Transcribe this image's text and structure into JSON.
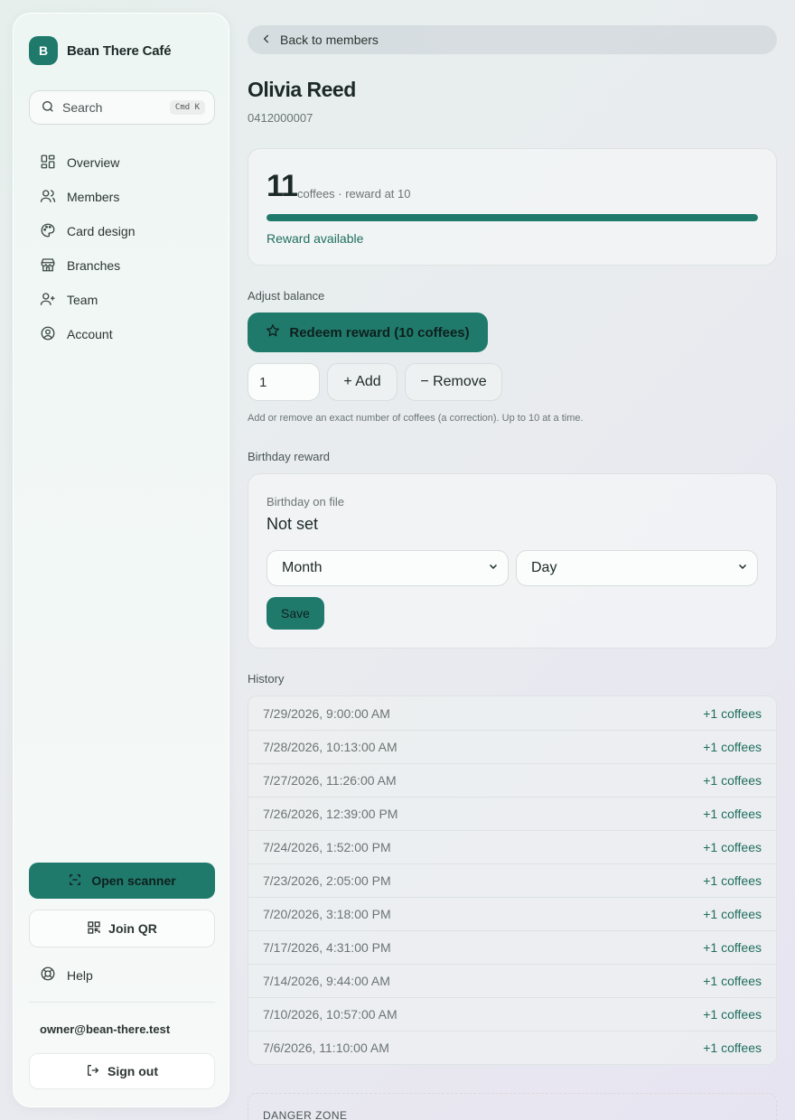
{
  "brand": {
    "logo_letter": "B",
    "name": "Bean There Café"
  },
  "search": {
    "placeholder": "Search",
    "shortcut": "Cmd K"
  },
  "nav": [
    {
      "label": "Overview",
      "icon": "grid-icon"
    },
    {
      "label": "Members",
      "icon": "users-icon"
    },
    {
      "label": "Card design",
      "icon": "palette-icon"
    },
    {
      "label": "Branches",
      "icon": "store-icon"
    },
    {
      "label": "Team",
      "icon": "user-plus-icon"
    },
    {
      "label": "Account",
      "icon": "user-circle-icon"
    }
  ],
  "sidebar_footer": {
    "scanner_label": "Open scanner",
    "joinqr_label": "Join QR",
    "help_label": "Help",
    "owner_email": "owner@bean-there.test",
    "signout_label": "Sign out"
  },
  "main": {
    "back_label": "Back to members",
    "member_name": "Olivia Reed",
    "member_phone": "0412000007",
    "balance": {
      "count": "11",
      "caption": "coffees · reward at 10",
      "progress_fraction": 1.0,
      "status": "Reward available"
    },
    "adjust": {
      "section_label": "Adjust balance",
      "redeem_label": "Redeem reward (10 coffees)",
      "quantity_value": "1",
      "add_label": "+ Add",
      "remove_label": "− Remove",
      "hint": "Add or remove an exact number of coffees (a correction). Up to 10 at a time."
    },
    "birthday": {
      "section_label": "Birthday reward",
      "label": "Birthday on file",
      "value": "Not set",
      "month_selected": "Month",
      "day_selected": "Day",
      "save_label": "Save"
    },
    "history": {
      "section_label": "History",
      "rows": [
        {
          "when": "7/29/2026, 9:00:00 AM",
          "delta": "+1 coffees"
        },
        {
          "when": "7/28/2026, 10:13:00 AM",
          "delta": "+1 coffees"
        },
        {
          "when": "7/27/2026, 11:26:00 AM",
          "delta": "+1 coffees"
        },
        {
          "when": "7/26/2026, 12:39:00 PM",
          "delta": "+1 coffees"
        },
        {
          "when": "7/24/2026, 1:52:00 PM",
          "delta": "+1 coffees"
        },
        {
          "when": "7/23/2026, 2:05:00 PM",
          "delta": "+1 coffees"
        },
        {
          "when": "7/20/2026, 3:18:00 PM",
          "delta": "+1 coffees"
        },
        {
          "when": "7/17/2026, 4:31:00 PM",
          "delta": "+1 coffees"
        },
        {
          "when": "7/14/2026, 9:44:00 AM",
          "delta": "+1 coffees"
        },
        {
          "when": "7/10/2026, 10:57:00 AM",
          "delta": "+1 coffees"
        },
        {
          "when": "7/6/2026, 11:10:00 AM",
          "delta": "+1 coffees"
        }
      ]
    },
    "danger_label": "DANGER ZONE"
  },
  "colors": {
    "accent": "#1f7a6c",
    "accent_text": "#1f6e5f"
  }
}
